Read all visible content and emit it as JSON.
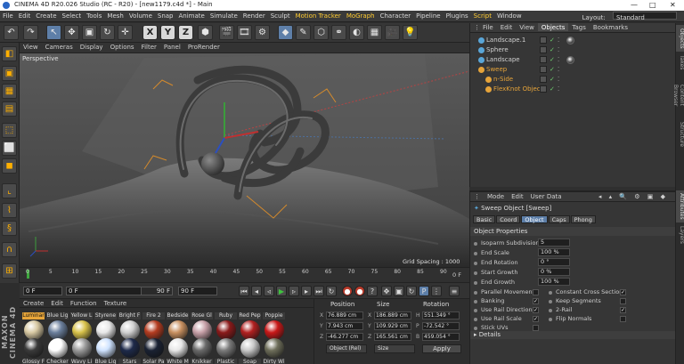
{
  "window": {
    "title": "CINEMA 4D R20.026 Studio (RC - R20) - [new1179.c4d *] - Main",
    "controls": [
      "—",
      "□",
      "✕"
    ]
  },
  "menubar": {
    "items": [
      "File",
      "Edit",
      "Create",
      "Select",
      "Tools",
      "Mesh",
      "Volume",
      "Snap",
      "Animate",
      "Simulate",
      "Render",
      "Sculpt",
      "Motion Tracker",
      "MoGraph",
      "Character",
      "Pipeline",
      "Plugins",
      "Script",
      "Window"
    ],
    "highlighted": [
      "Motion Tracker",
      "MoGraph",
      "Script"
    ],
    "layout_label": "Layout:",
    "layout_value": "Standard"
  },
  "toolbar": {
    "axis_buttons": [
      "X",
      "Y",
      "Z"
    ]
  },
  "viewport": {
    "menu": [
      "View",
      "Cameras",
      "Display",
      "Options",
      "Filter",
      "Panel",
      "ProRender"
    ],
    "label": "Perspective",
    "grid_spacing": "Grid Spacing : 1000 cm"
  },
  "timeline": {
    "ticks": [
      "0",
      "5",
      "10",
      "15",
      "20",
      "25",
      "30",
      "35",
      "40",
      "45",
      "50",
      "55",
      "60",
      "65",
      "70",
      "75",
      "80",
      "85",
      "90"
    ],
    "end_label": "0 F"
  },
  "transport": {
    "current_frame": "0 F",
    "start_frame": "0 F",
    "end_field": "90 F",
    "end_field2": "90 F"
  },
  "materials": {
    "menu": [
      "Create",
      "Edit",
      "Function",
      "Texture"
    ],
    "row1": [
      "Luminar",
      "Blue Lig",
      "Yellow L",
      "Styrene",
      "Bright F",
      "Fire 2",
      "Bedside",
      "Rose Gl",
      "Ruby",
      "Red Pep",
      "Poppie"
    ],
    "row2": [
      "Glossy F",
      "Checker",
      "Wavy Li",
      "Blue Lig",
      "Stars",
      "Solar Pa",
      "White M",
      "Knikker",
      "Plastic",
      "Soap",
      "Dirty Wi"
    ],
    "selected": "Luminar"
  },
  "coordinates": {
    "headers": [
      "Position",
      "Size",
      "Rotation"
    ],
    "rows": [
      {
        "axis": "X",
        "pos": "76.889 cm",
        "size": "186.889 cm",
        "rot_axis": "H",
        "rot": "551.349 °"
      },
      {
        "axis": "Y",
        "pos": "7.943 cm",
        "size": "109.929 cm",
        "rot_axis": "P",
        "rot": "-72.542 °"
      },
      {
        "axis": "Z",
        "pos": "-46.277 cm",
        "size": "165.561 cm",
        "rot_axis": "B",
        "rot": "459.054 °"
      }
    ],
    "mode": "Object (Rel)",
    "size_mode": "Size",
    "apply": "Apply"
  },
  "objects_panel": {
    "menu": [
      "File",
      "Edit",
      "View",
      "Objects",
      "Tags",
      "Bookmarks"
    ],
    "active_tab": "Objects",
    "rows": [
      {
        "name": "Landscape.1",
        "indent": 0,
        "color": "normal",
        "tag": true
      },
      {
        "name": "Sphere",
        "indent": 0,
        "color": "normal",
        "tag": false
      },
      {
        "name": "Landscape",
        "indent": 0,
        "color": "normal",
        "tag": true
      },
      {
        "name": "Sweep",
        "indent": 0,
        "color": "orange",
        "tag": false
      },
      {
        "name": "n-Side",
        "indent": 1,
        "color": "orange",
        "tag": false
      },
      {
        "name": "FlexKnot Object",
        "indent": 1,
        "color": "orange",
        "tag": false
      }
    ]
  },
  "attributes": {
    "menu": [
      "Mode",
      "Edit",
      "User Data"
    ],
    "object_title": "Sweep Object [Sweep]",
    "tabs": [
      "Basic",
      "Coord",
      "Object",
      "Caps",
      "Phong"
    ],
    "active_tab": "Object",
    "section": "Object Properties",
    "props": [
      {
        "label": "Isoparm Subdivision",
        "value": "5"
      },
      {
        "label": "End Scale",
        "value": "100 %"
      },
      {
        "label": "End Rotation",
        "value": "0 °"
      },
      {
        "label": "Start Growth",
        "value": "0 %"
      },
      {
        "label": "End Growth",
        "value": "100 %"
      }
    ],
    "checks_left": [
      {
        "label": "Parallel Movement",
        "checked": false
      },
      {
        "label": "Banking",
        "checked": true
      },
      {
        "label": "Use Rail Direction",
        "checked": true
      },
      {
        "label": "Use Rail Scale",
        "checked": true
      },
      {
        "label": "Stick UVs",
        "checked": false
      }
    ],
    "checks_right": [
      {
        "label": "Constant Cross Section",
        "checked": true
      },
      {
        "label": "Keep Segments",
        "checked": false
      },
      {
        "label": "2-Rail",
        "checked": true
      },
      {
        "label": "Flip Normals",
        "checked": false
      }
    ],
    "details": "Details"
  },
  "right_strip": {
    "tabs": [
      "Objects",
      "Takes",
      "Content Browser",
      "Structure",
      "Attributes",
      "Layers"
    ],
    "active": [
      "Objects",
      "Attributes"
    ]
  }
}
